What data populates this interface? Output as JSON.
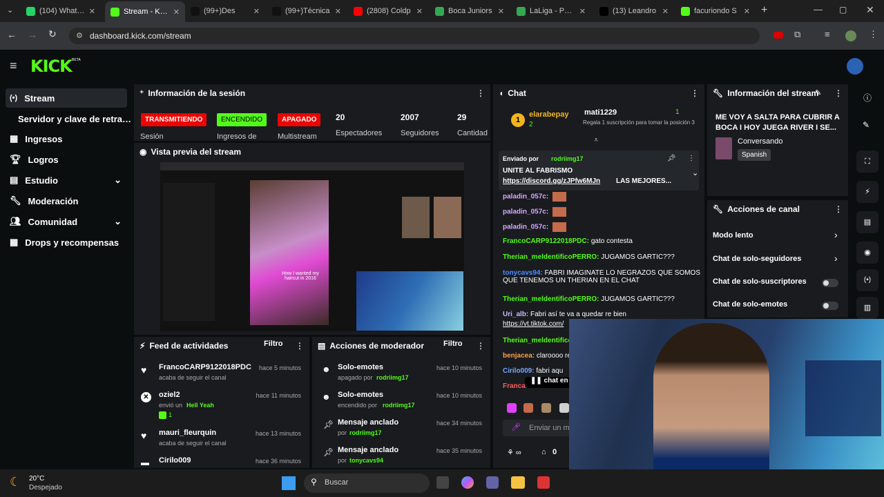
{
  "browser": {
    "tabs": [
      {
        "label": "(104) WhatsA",
        "color": "#25d366"
      },
      {
        "label": "Stream - Kick",
        "color": "#53fc18",
        "active": true
      },
      {
        "label": "(99+)Des",
        "color": "#111111"
      },
      {
        "label": "(99+)Técnica",
        "color": "#111111"
      },
      {
        "label": "(2808) Coldp",
        "color": "#ff0000"
      },
      {
        "label": "Boca Juniors",
        "color": "#34a853"
      },
      {
        "label": "LaLiga - POS",
        "color": "#34a853"
      },
      {
        "label": "(13) Leandro",
        "color": "#000000"
      },
      {
        "label": "facuriondo S",
        "color": "#53fc18"
      }
    ],
    "url": "dashboard.kick.com/stream"
  },
  "brand": {
    "logo": "KICK",
    "beta": "BETA"
  },
  "sidebar": {
    "items": [
      "Stream",
      "Servidor y clave de retransm",
      "Ingresos",
      "Logros",
      "Estudio",
      "Moderación",
      "Comunidad",
      "Drops y recompensas"
    ]
  },
  "session": {
    "title": "Información de la sesión",
    "badges": [
      "TRANSMITIENDO",
      "ENCENDIDO",
      "APAGADO"
    ],
    "labels": [
      "Sesión",
      "Ingresos de",
      "Multistream"
    ],
    "stats": [
      {
        "value": "20",
        "label": "Espectadores"
      },
      {
        "value": "2007",
        "label": "Seguidores"
      },
      {
        "value": "29",
        "label": "Cantidad"
      }
    ]
  },
  "preview": {
    "title": "Vista previa del stream",
    "overlay_text": "How I wanted my haircut in 2016"
  },
  "activity": {
    "title": "Feed de actividades",
    "filter": "Filtro",
    "items": [
      {
        "name": "FrancoCARP9122018PDC",
        "sub": "acaba de seguir el canal",
        "time": "hace 5 minutos"
      },
      {
        "name": "oziel2",
        "sub": "envió un",
        "sub2": "Hell Yeah",
        "extra": "1",
        "time": "hace 11 minutos"
      },
      {
        "name": "mauri_fleurquin",
        "sub": "acaba de seguir el canal",
        "time": "hace 13 minutos"
      },
      {
        "name": "Cirilo009",
        "sub": "",
        "time": "hace 36 minutos"
      }
    ]
  },
  "modactions": {
    "title": "Acciones de moderador",
    "filter": "Filtro",
    "items": [
      {
        "name": "Solo-emotes",
        "sub": "apagado por",
        "by": "rodriimg17",
        "time": "hace 10 minutos"
      },
      {
        "name": "Solo-emotes",
        "sub": "encendido por",
        "by": "rodriimg17",
        "time": "hace 10 minutos"
      },
      {
        "name": "Mensaje anclado",
        "sub": "por",
        "by": "rodriimg17",
        "time": "hace 34 minutos"
      },
      {
        "name": "Mensaje anclado",
        "sub": "por",
        "by": "tonycavs94",
        "time": "hace 35 minutos"
      }
    ]
  },
  "chat": {
    "title": "Chat",
    "top": {
      "rank": "1",
      "user1": "elarabepay",
      "count1": "2",
      "user2": "mati1229",
      "count2": "1",
      "gift_text": "Regala 1 suscripción para tomar la posición 3"
    },
    "pinned": {
      "label": "Enviado por",
      "by": "rodriimg17",
      "text": "UNITE AL FABRISMO",
      "link": "https://discord.gg/zJPfw6MJn",
      "rest": " LAS MEJORES..."
    },
    "messages": [
      {
        "user": "paladin_057c:",
        "text": "",
        "color": "#d6a8ff"
      },
      {
        "user": "paladin_057c:",
        "text": "",
        "color": "#d6a8ff"
      },
      {
        "user": "paladin_057c:",
        "text": "",
        "color": "#d6a8ff"
      },
      {
        "user": "FrancoCARP9122018PDC:",
        "text": " gato contesta",
        "color": "#53fc18"
      },
      {
        "user": "Therian_meldentificoPERRO:",
        "text": " JUGAMOS GARTIC???",
        "color": "#53fc18"
      },
      {
        "user": "tonycavs94:",
        "text": " FABRI IMAGINATE LO NEGRAZOS QUE SOMOS QUE TENEMOS UN THERIAN EN EL CHAT",
        "color": "#4c8cff"
      },
      {
        "user": "Therian_meldentificoPERRO:",
        "text": " JUGAMOS GARTIC???",
        "color": "#53fc18"
      },
      {
        "user": "Uri_alb:",
        "text": " Fabri así te va a quedar re bien",
        "color": "#c6b8ff"
      },
      {
        "user": "",
        "text": "https://vt.tiktok.com/",
        "color": "#fff"
      },
      {
        "user": "Therian_meldentifico",
        "text": "",
        "color": "#53fc18"
      },
      {
        "user": "benjacea:",
        "text": " claroooo re",
        "color": "#ff9f43"
      },
      {
        "user": "Cirilo009:",
        "text": " fabri aqu",
        "color": "#7aa7ff"
      },
      {
        "user": "Franca...",
        "text": "",
        "color": "#ff5c5c"
      }
    ],
    "paused": "chat en",
    "input_placeholder": "Enviar un m",
    "viewers": "0"
  },
  "streaminfo": {
    "title": "Información del stream",
    "stream_title": "ME VOY A SALTA PARA CUBRIR A BOCA I HOY JUEGA RIVER I SE...",
    "category": "Conversando",
    "tag": "Spanish"
  },
  "channel": {
    "title": "Acciones de canal",
    "rows": [
      "Modo lento",
      "Chat de solo-seguidores",
      "Chat de solo-suscriptores",
      "Chat de solo-emotes"
    ]
  },
  "taskbar": {
    "temp": "20°C",
    "weather": "Despejado",
    "search": "Buscar"
  },
  "colors": {
    "accent": "#53fc18",
    "red": "#eb0400",
    "panel": "#191b1f"
  }
}
